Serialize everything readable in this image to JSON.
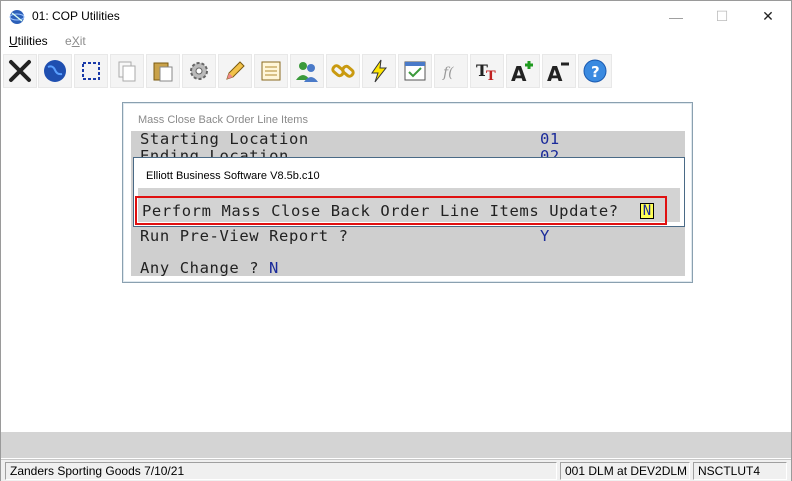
{
  "window": {
    "title": "01: COP Utilities"
  },
  "menu": {
    "utilities": "Utilities",
    "exit": "eXit"
  },
  "toolbar": {
    "buttons": [
      "close-icon",
      "globe-icon",
      "select-icon",
      "copy-icon",
      "paste-icon",
      "settings-icon",
      "edit-icon",
      "notes-icon",
      "users-icon",
      "link-icon",
      "lightning-icon",
      "window-icon",
      "function-icon",
      "font-size-icon",
      "font-larger-icon",
      "font-smaller-icon",
      "help-icon"
    ]
  },
  "panel": {
    "title": "Mass Close Back Order Line Items",
    "starting_location_label": "Starting Location",
    "starting_location_value": "01",
    "ending_location_label": "Ending Location",
    "ending_location_value": "02",
    "preview_label": "Run Pre-View Report ?",
    "preview_value": "Y",
    "any_change_label": "Any Change ?",
    "any_change_value": "N"
  },
  "dialog": {
    "title": "Elliott Business Software V8.5b.c10",
    "question": "Perform Mass Close Back Order Line Items Update?",
    "answer": "N"
  },
  "status": {
    "company": "Zanders Sporting Goods 7/10/21",
    "user": "001 DLM at DEV2DLM",
    "program": "NSCTLUT4"
  },
  "colors": {
    "value_text": "#1a2a9a",
    "highlight": "#e01010",
    "cursor": "#ffff55"
  }
}
